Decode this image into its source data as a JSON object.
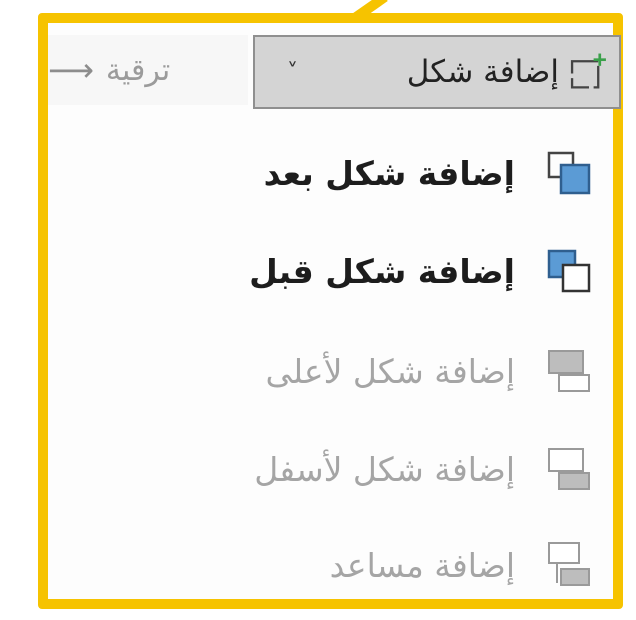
{
  "toolbar": {
    "add_shape_label": "إضافة شكل",
    "promote_label": "ترقية",
    "chevron": "˅"
  },
  "menu": {
    "items": [
      {
        "label": "إضافة شكل بعد",
        "enabled": true,
        "icon": "add-shape-after-icon"
      },
      {
        "label": "إضافة شكل قبل",
        "enabled": true,
        "icon": "add-shape-before-icon"
      },
      {
        "label": "إضافة شكل لأعلى",
        "enabled": false,
        "icon": "add-shape-above-icon"
      },
      {
        "label": "إضافة شكل لأسفل",
        "enabled": false,
        "icon": "add-shape-below-icon"
      },
      {
        "label": "إضافة مساعد",
        "enabled": false,
        "icon": "add-assistant-icon"
      }
    ]
  },
  "colors": {
    "highlight_border": "#f6c300",
    "shape_blue": "#5b9bd5",
    "disabled_gray": "#a5a5a5"
  }
}
